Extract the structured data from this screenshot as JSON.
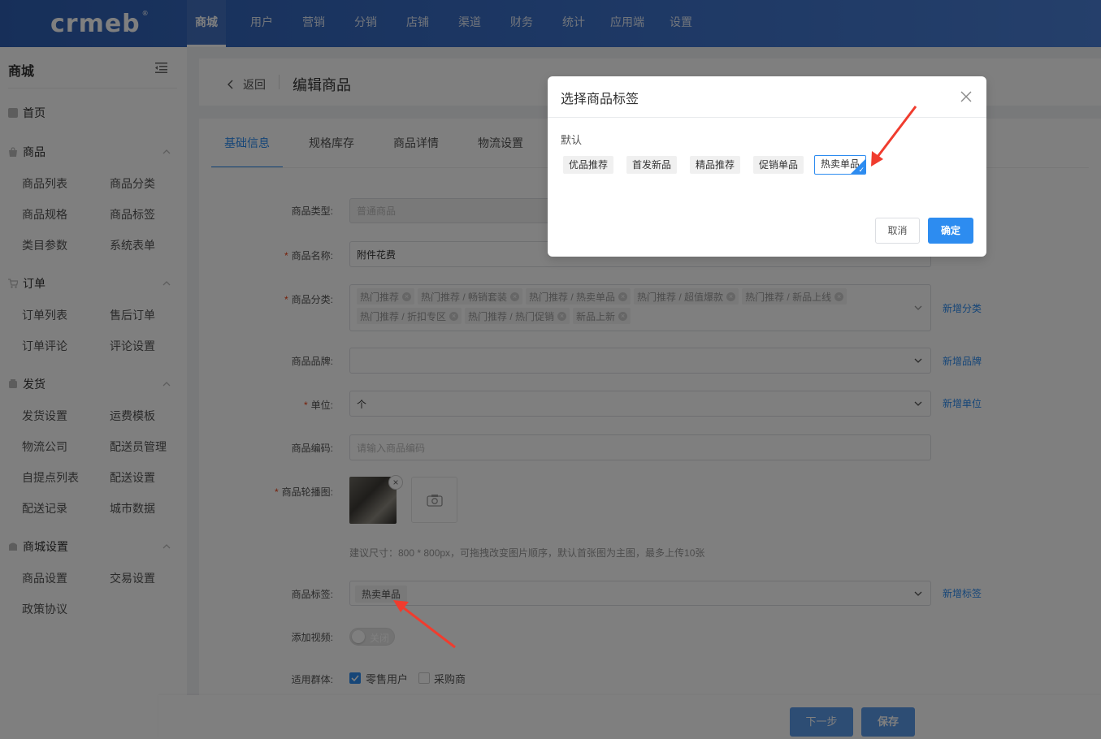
{
  "colors": {
    "accent": "#2d8cf0",
    "required": "#ed4014",
    "topbar": "#3a6fc8",
    "annotation_arrow": "#f03c2e"
  },
  "logo": {
    "text": "crmeb",
    "mark": "®"
  },
  "topnav": {
    "items": [
      "商城",
      "用户",
      "营销",
      "分销",
      "店铺",
      "渠道",
      "财务",
      "统计",
      "应用端",
      "设置"
    ],
    "active": "商城"
  },
  "sidebar": {
    "title": "商城",
    "home": "首页",
    "groups": [
      {
        "label": "商品",
        "icon": "bag-icon",
        "items": [
          "商品列表",
          "商品分类",
          "商品规格",
          "商品标签",
          "类目参数",
          "系统表单"
        ]
      },
      {
        "label": "订单",
        "icon": "cart-icon",
        "items": [
          "订单列表",
          "售后订单",
          "订单评论",
          "评论设置"
        ]
      },
      {
        "label": "发货",
        "icon": "box-icon",
        "items": [
          "发货设置",
          "运费模板",
          "物流公司",
          "配送员管理",
          "自提点列表",
          "配送设置",
          "配送记录",
          "城市数据"
        ]
      },
      {
        "label": "商城设置",
        "icon": "store-icon",
        "items": [
          "商品设置",
          "交易设置",
          "政策协议"
        ]
      }
    ]
  },
  "header": {
    "back": "返回",
    "title": "编辑商品"
  },
  "tabs": [
    "基础信息",
    "规格库存",
    "商品详情",
    "物流设置"
  ],
  "form": {
    "type": {
      "label": "商品类型:",
      "value": "普通商品"
    },
    "name": {
      "label": "商品名称:",
      "value": "附件花费"
    },
    "category": {
      "label": "商品分类:",
      "chips": [
        "热门推荐",
        "热门推荐 / 畅销套装",
        "热门推荐 / 热卖单品",
        "热门推荐 / 超值爆款",
        "热门推荐 / 新品上线",
        "热门推荐 / 折扣专区",
        "热门推荐 / 热门促销",
        "新品上新"
      ],
      "link": "新增分类"
    },
    "brand": {
      "label": "商品品牌:",
      "value": "",
      "link": "新增品牌"
    },
    "unit": {
      "label": "单位:",
      "value": "个",
      "link": "新增单位"
    },
    "code": {
      "label": "商品编码:",
      "placeholder": "请输入商品编码"
    },
    "carousel": {
      "label": "商品轮播图:",
      "remove": "×",
      "hint": "建议尺寸：800 * 800px，可拖拽改变图片顺序，默认首张图为主图，最多上传10张"
    },
    "tags": {
      "label": "商品标签:",
      "value": "热卖单品",
      "link": "新增标签"
    },
    "video": {
      "label": "添加视频:",
      "switch": "关闭",
      "on": false
    },
    "audience": {
      "label": "适用群体:",
      "options": [
        {
          "label": "零售用户",
          "checked": true
        },
        {
          "label": "采购商",
          "checked": false
        }
      ]
    }
  },
  "footer": {
    "next": "下一步",
    "save": "保存"
  },
  "modal": {
    "title": "选择商品标签",
    "group": "默认",
    "tags": [
      {
        "label": "优品推荐",
        "selected": false
      },
      {
        "label": "首发新品",
        "selected": false
      },
      {
        "label": "精品推荐",
        "selected": false
      },
      {
        "label": "促销单品",
        "selected": false
      },
      {
        "label": "热卖单品",
        "selected": true
      }
    ],
    "cancel": "取消",
    "confirm": "确定"
  }
}
